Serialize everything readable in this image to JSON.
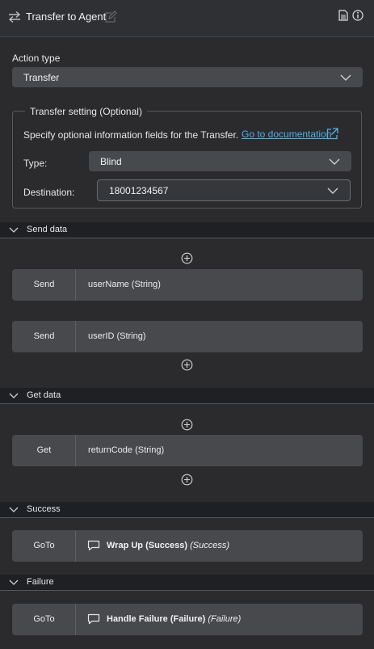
{
  "header": {
    "title": "Transfer to Agent"
  },
  "action_type": {
    "label": "Action type",
    "value": "Transfer"
  },
  "transfer_setting": {
    "legend": "Transfer setting (Optional)",
    "description": "Specify optional information fields for the Transfer.",
    "doc_link": "Go to documentation",
    "type_label": "Type:",
    "type_value": "Blind",
    "destination_label": "Destination:",
    "destination_value": "18001234567"
  },
  "sections": {
    "send_data": "Send data",
    "get_data": "Get data",
    "success": "Success",
    "failure": "Failure"
  },
  "send_rows": [
    {
      "tag": "Send",
      "value": "userName (String)"
    },
    {
      "tag": "Send",
      "value": "userID (String)"
    }
  ],
  "get_rows": [
    {
      "tag": "Get",
      "value": "returnCode (String)"
    }
  ],
  "success_row": {
    "tag": "GoTo",
    "target": "Wrap Up (Success)",
    "target_note": "(Success)"
  },
  "failure_row": {
    "tag": "GoTo",
    "target": "Handle Failure (Failure)",
    "target_note": "(Failure)"
  },
  "icons": {
    "header": [
      "swap-arrows-icon",
      "edit-icon",
      "document-icon",
      "info-icon"
    ],
    "expand": "chevron-down-icon",
    "add": "plus-circle-icon",
    "goto": "chat-bubble-icon",
    "external": "external-link-icon"
  },
  "colors": {
    "background": "#2b2b2d",
    "field": "#48494d",
    "section": "#1f2023",
    "link": "#4fb0e8"
  }
}
